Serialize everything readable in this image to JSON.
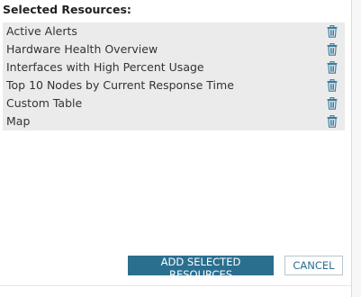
{
  "dialog": {
    "heading": "Selected Resources:",
    "resources": [
      {
        "label": "Active Alerts",
        "action_icon": "trash-icon"
      },
      {
        "label": "Hardware Health Overview",
        "action_icon": "trash-icon"
      },
      {
        "label": "Interfaces with High Percent Usage",
        "action_icon": "trash-icon"
      },
      {
        "label": "Top 10 Nodes by Current Response Time",
        "action_icon": "trash-icon"
      },
      {
        "label": "Custom Table",
        "action_icon": "trash-icon"
      },
      {
        "label": "Map",
        "action_icon": "trash-icon"
      }
    ],
    "add_button_label": "ADD SELECTED RESOURCES",
    "cancel_button_label": "CANCEL"
  },
  "colors": {
    "primary": "#2b6f8f",
    "list_background": "#ebebeb",
    "icon": "#3a7ca0"
  }
}
